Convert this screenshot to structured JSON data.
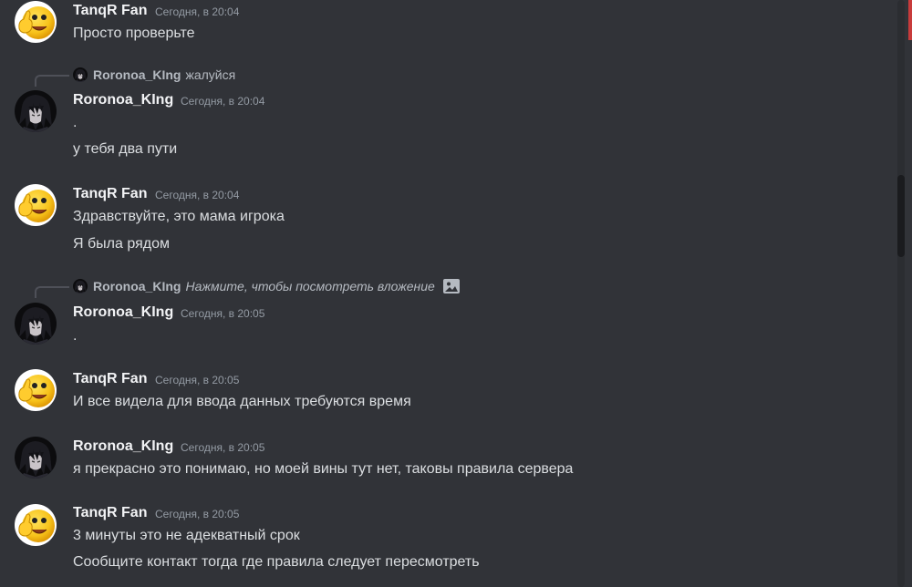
{
  "messages": [
    {
      "author": "TanqR Fan",
      "time": "Сегодня, в 20:04",
      "lines": [
        "Просто проверьте"
      ]
    },
    {
      "reply": {
        "author": "Roronoa_KIng",
        "text": "жалуйся"
      },
      "author": "Roronoa_KIng",
      "time": "Сегодня, в 20:04",
      "lines": [
        ".",
        "у тебя два пути"
      ]
    },
    {
      "author": "TanqR Fan",
      "time": "Сегодня, в 20:04",
      "lines": [
        "Здравствуйте, это мама игрока",
        "Я была рядом"
      ]
    },
    {
      "reply": {
        "author": "Roronoa_KIng",
        "text": "Нажмите, чтобы посмотреть вложение"
      },
      "author": "Roronoa_KIng",
      "time": "Сегодня, в 20:05",
      "lines": [
        "."
      ]
    },
    {
      "author": "TanqR Fan",
      "time": "Сегодня, в 20:05",
      "lines": [
        "И все видела для ввода данных требуются время"
      ]
    },
    {
      "author": "Roronoa_KIng",
      "time": "Сегодня, в 20:05",
      "lines": [
        "я прекрасно это понимаю, но моей вины тут нет, таковы правила сервера"
      ]
    },
    {
      "author": "TanqR Fan",
      "time": "Сегодня, в 20:05",
      "lines": [
        "3 минуты это не адекватный срок",
        "Сообщите контакт тогда где правила следует пересмотреть"
      ]
    }
  ],
  "icons": {
    "emoji_avatar": "thumbs-up-emoji-avatar",
    "anime_avatar": "dark-anime-avatar",
    "attachment": "image-icon"
  },
  "colors": {
    "background": "#313338",
    "author": "#f2f3f5",
    "timestamp": "#949ba4",
    "text": "#dbdee1"
  }
}
